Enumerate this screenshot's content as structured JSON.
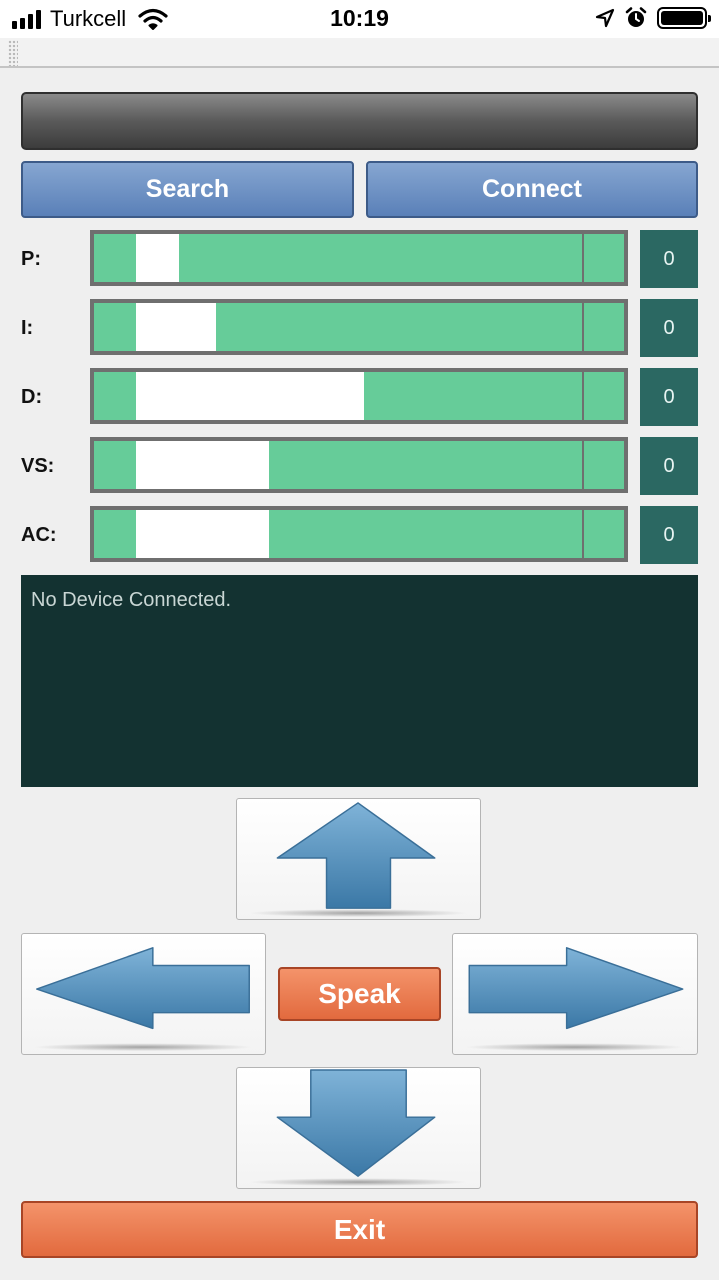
{
  "status_bar": {
    "carrier": "Turkcell",
    "time": "10:19",
    "icons": [
      "signal-icon",
      "wifi-icon",
      "location-arrow-icon",
      "alarm-clock-icon",
      "battery-icon"
    ]
  },
  "toolbar": {
    "search_label": "Search",
    "connect_label": "Connect"
  },
  "sliders": [
    {
      "label": "P:",
      "value": "0",
      "thumb_start": 0.08,
      "thumb_end": 0.16
    },
    {
      "label": "I:",
      "value": "0",
      "thumb_start": 0.08,
      "thumb_end": 0.23
    },
    {
      "label": "D:",
      "value": "0",
      "thumb_start": 0.08,
      "thumb_end": 0.51
    },
    {
      "label": "VS:",
      "value": "0",
      "thumb_start": 0.08,
      "thumb_end": 0.33
    },
    {
      "label": "AC:",
      "value": "0",
      "thumb_start": 0.08,
      "thumb_end": 0.33
    }
  ],
  "console": {
    "message": "No Device Connected."
  },
  "controls": {
    "speak_label": "Speak",
    "exit_label": "Exit"
  },
  "colors": {
    "slider_track": "#66cc99",
    "value_box": "#2b6862",
    "console_bg": "#133231",
    "button_blue": "#6a8fc4",
    "button_orange": "#e8774a",
    "arrow_blue": "#4a86b4"
  }
}
